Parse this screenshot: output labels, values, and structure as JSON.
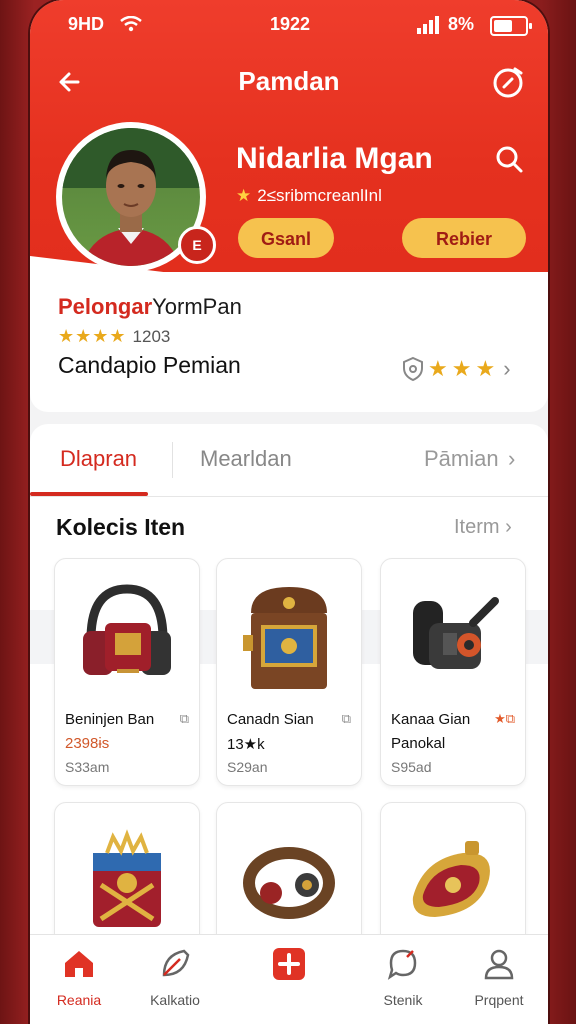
{
  "status_bar": {
    "left_text": "9HD",
    "time": "1922",
    "battery_text": "8%"
  },
  "header": {
    "title": "Pamdan",
    "back_icon": "back-arrow-icon",
    "action_icon": "compass-icon"
  },
  "profile": {
    "name": "Nidarlia Mgan",
    "subtitle": "2≤sribmcreanl​Inl",
    "badge_text": "E",
    "button_primary": "Gsanl",
    "button_secondary": "Rebier",
    "accent_color": "#e5311f",
    "button_color": "#f6c24e"
  },
  "info_card": {
    "title_red": "Pelongar",
    "title_dark": "YormPan",
    "rating_count": "1203",
    "stars": "★★★★",
    "subtitle": "Candapio Pemian"
  },
  "tabs": {
    "items": [
      "Dlapran",
      "Mearldan",
      "Pāmian"
    ],
    "active": "Dlapran"
  },
  "section": {
    "title": "Kolecis Iten",
    "more": "Iterm"
  },
  "items": [
    {
      "name": "Beninjen Ban",
      "price": "2398ɨs",
      "stock": "S33am",
      "icon": "headphones-icon"
    },
    {
      "name": "Canadn Sian",
      "price": "13★k",
      "stock": "S29an",
      "icon": "treasure-chest-icon"
    },
    {
      "name": "Kanaa Gian",
      "name2": "Panokal",
      "stock": "S95ad",
      "icon": "camera-headset-icon"
    },
    {
      "name": "",
      "icon": "chest-box-icon"
    },
    {
      "name": "",
      "icon": "ring-icon"
    },
    {
      "name": "",
      "icon": "amulet-icon"
    }
  ],
  "bottom_nav": [
    {
      "label": "Reania",
      "icon": "home-icon",
      "active": true
    },
    {
      "label": "Kalkatio",
      "icon": "feather-icon",
      "active": false
    },
    {
      "label": "",
      "icon": "plus-icon",
      "active": false
    },
    {
      "label": "Stenik",
      "icon": "chat-icon",
      "active": false
    },
    {
      "label": "Prqpent",
      "icon": "user-icon",
      "active": false
    }
  ]
}
